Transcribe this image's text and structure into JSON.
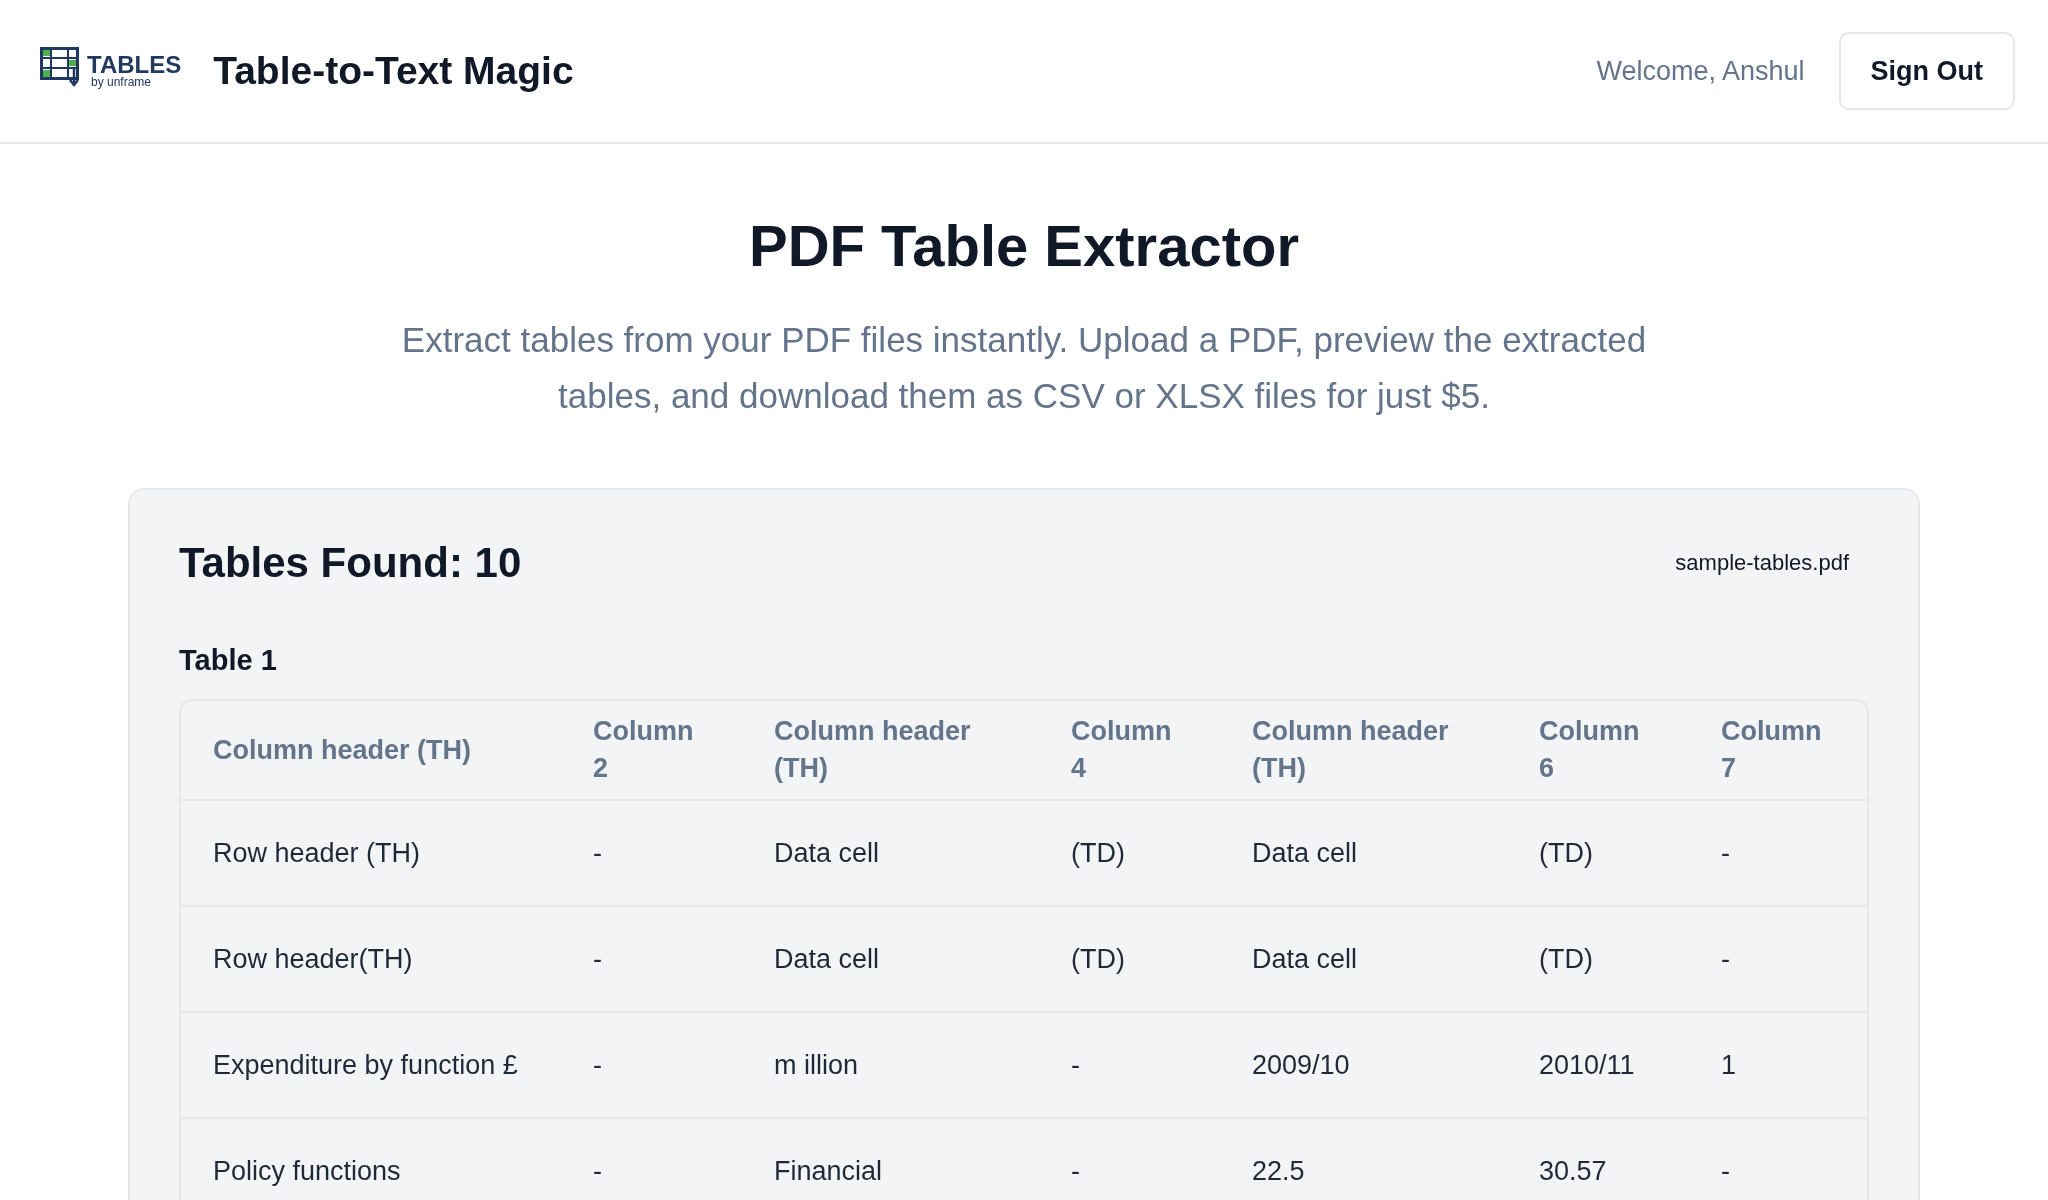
{
  "header": {
    "logo": {
      "wordmark": "TABLES",
      "tagline": "by unframe"
    },
    "app_title": "Table-to-Text Magic",
    "welcome": "Welcome, Anshul",
    "sign_out": "Sign Out"
  },
  "hero": {
    "title": "PDF Table Extractor",
    "subtitle": "Extract tables from your PDF files instantly. Upload a PDF, preview the extracted tables, and download them as CSV or XLSX files for just $5."
  },
  "results": {
    "heading": "Tables Found: 10",
    "file_name": "sample-tables.pdf",
    "tables": [
      {
        "title": "Table 1",
        "columns": [
          "Column header (TH)",
          "Column 2",
          "Column header (TH)",
          "Column 4",
          "Column header (TH)",
          "Column 6",
          "Column 7"
        ],
        "rows": [
          [
            "Row header (TH)",
            "-",
            "Data cell",
            "(TD)",
            "Data cell",
            "(TD)",
            "-"
          ],
          [
            "Row header(TH)",
            "-",
            "Data cell",
            "(TD)",
            "Data cell",
            "(TD)",
            "-"
          ],
          [
            "Expenditure by function £",
            "-",
            "m illion",
            "-",
            "2009/10",
            "2010/11",
            "1"
          ],
          [
            "Policy functions",
            "-",
            "Financial",
            "-",
            "22.5",
            "30.57",
            "-"
          ]
        ]
      }
    ]
  }
}
